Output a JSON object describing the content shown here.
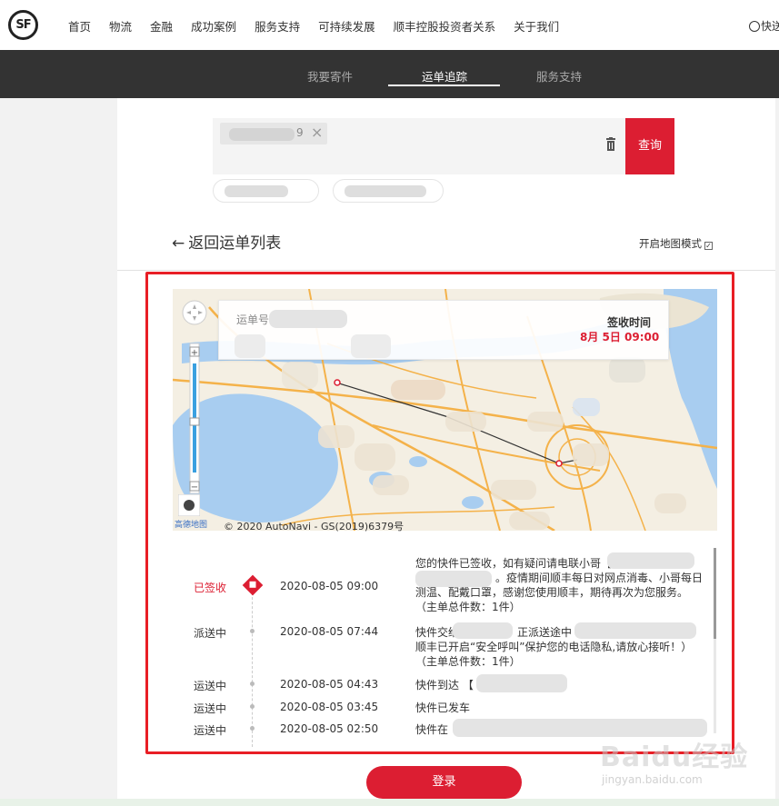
{
  "logo_text": "SF",
  "nav": {
    "items": [
      "首页",
      "物流",
      "金融",
      "成功案例",
      "服务支持",
      "可持续发展",
      "顺丰控股投资者关系",
      "关于我们"
    ],
    "right_label": "快送"
  },
  "subnav": {
    "tabs": [
      "我要寄件",
      "运单追踪",
      "服务支持"
    ],
    "active": "运单追踪"
  },
  "search": {
    "chip_suffix": "9",
    "query_button": "查询"
  },
  "back_label": "返回运单列表",
  "map_mode_label": "开启地图模式",
  "map_mode_checked": true,
  "map": {
    "waybill_label": "运单号",
    "sign_time_label": "签收时间",
    "sign_time_value": "8月 5日 09:00",
    "copyright": "© 2020 AutoNavi - GS(2019)6379号",
    "attribution": "高德地图"
  },
  "timeline": [
    {
      "status": "已签收",
      "time": "2020-08-05 09:00",
      "lines": [
        "您的快件已签收，如有疑问请电联小哥【",
        "。疫情期间顺丰每日对网点消毒、小哥每日",
        "测温、配戴口罩，感谢您使用顺丰，期待再次为您服务。",
        "（主单总件数：1件）"
      ],
      "current": true
    },
    {
      "status": "派送中",
      "time": "2020-08-05 07:44",
      "lines": [
        "快件交给",
        "正派送途中",
        "顺丰已开启“安全呼叫”保护您的电话隐私,请放心接听！）",
        "（主单总件数：1件）"
      ]
    },
    {
      "status": "运送中",
      "time": "2020-08-05 04:43",
      "lines": [
        "快件到达 【"
      ]
    },
    {
      "status": "运送中",
      "time": "2020-08-05 03:45",
      "lines": [
        "快件已发车"
      ]
    },
    {
      "status": "运送中",
      "time": "2020-08-05 02:50",
      "lines": [
        "快件在"
      ]
    }
  ],
  "login_button": "登录",
  "watermark": {
    "main": "Baidu经验",
    "sub": "jingyan.baidu.com"
  },
  "colors": {
    "brand_red": "#dc1e32",
    "frame_red": "#e81e25",
    "subnav_bg": "#333333"
  }
}
